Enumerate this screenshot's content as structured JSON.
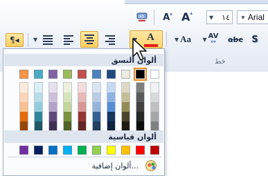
{
  "ribbon": {
    "font_name": "Arial",
    "font_size": "١٤",
    "grow_font_label": "A",
    "shrink_font_label": "A",
    "font_color_letter": "A",
    "change_case_label": "Aa",
    "char_spacing_label": "AV",
    "strike_label": "abc",
    "shadow_label": "S",
    "group_label": "خط"
  },
  "panel": {
    "theme_colors_title": "ألوان النسق",
    "standard_colors_title": "ألوان قياسية",
    "more_colors_label": "ألوان إضافية...",
    "theme_top_row": [
      "#ffffff",
      "#000000",
      "#eeece1",
      "#1f497d",
      "#4f81bd",
      "#c0504d",
      "#9bbb59",
      "#8064a2",
      "#4bacc6",
      "#f79646"
    ],
    "theme_columns": [
      [
        "#f2f2f2",
        "#d9d9d9",
        "#bfbfbf",
        "#a6a6a6",
        "#808080"
      ],
      [
        "#7f7f7f",
        "#595959",
        "#404040",
        "#262626",
        "#0d0d0d"
      ],
      [
        "#ddd9c3",
        "#c4bd97",
        "#948a54",
        "#4a452a",
        "#1e1c11"
      ],
      [
        "#c6d9f1",
        "#8db3e2",
        "#548dd4",
        "#17365d",
        "#0f243e"
      ],
      [
        "#dbe5f1",
        "#b8cce4",
        "#95b3d7",
        "#366092",
        "#244061"
      ],
      [
        "#f2dcdb",
        "#e6b8b7",
        "#d99694",
        "#953735",
        "#632523"
      ],
      [
        "#ebf1dd",
        "#d7e3bc",
        "#c3d69b",
        "#76923c",
        "#4f6228"
      ],
      [
        "#e5e0ec",
        "#ccc1d9",
        "#b3a2c7",
        "#5f497a",
        "#3f3151"
      ],
      [
        "#dbeef3",
        "#b7dde8",
        "#92cddc",
        "#31859b",
        "#205867"
      ],
      [
        "#fdeada",
        "#fbd5b5",
        "#fac08f",
        "#e36c09",
        "#974806"
      ]
    ],
    "standard_row": [
      "#c00000",
      "#ff0000",
      "#ffc000",
      "#ffff00",
      "#92d050",
      "#00b050",
      "#00b0f0",
      "#0070c0",
      "#002060",
      "#7030a0"
    ],
    "selected_color": "#000000"
  },
  "colors": {
    "highlight": "#ffd36c",
    "font_color_underline": "#e31b1b"
  }
}
